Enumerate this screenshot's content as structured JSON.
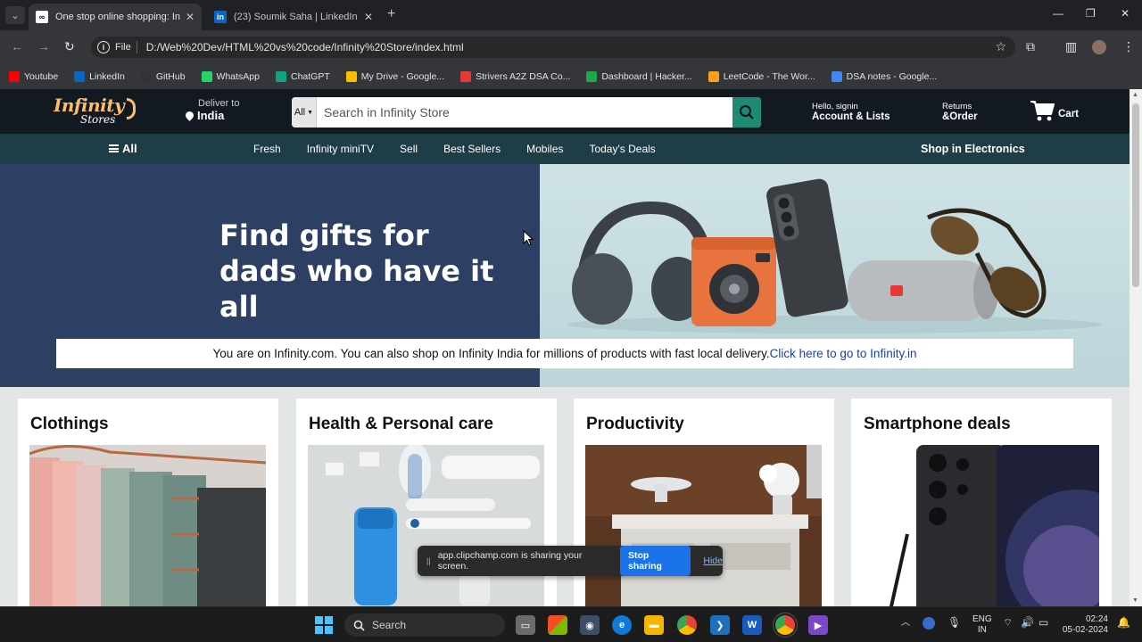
{
  "browser": {
    "tabs": [
      {
        "title": "One stop online shopping: Infin",
        "active": true
      },
      {
        "title": "(23) Soumik Saha | LinkedIn",
        "active": false
      }
    ],
    "url_scheme": "File",
    "url": "D:/Web%20Dev/HTML%20vs%20code/Infinity%20Store/index.html",
    "bookmarks": [
      {
        "label": "Youtube",
        "color": "#ff0000"
      },
      {
        "label": "LinkedIn",
        "color": "#0a66c2"
      },
      {
        "label": "GitHub",
        "color": "#333333"
      },
      {
        "label": "WhatsApp",
        "color": "#25d366"
      },
      {
        "label": "ChatGPT",
        "color": "#10a37f"
      },
      {
        "label": "My Drive - Google...",
        "color": "#fbbc04"
      },
      {
        "label": "Strivers A2Z DSA Co...",
        "color": "#e53935"
      },
      {
        "label": "Dashboard | Hacker...",
        "color": "#1ba94c"
      },
      {
        "label": "LeetCode - The Wor...",
        "color": "#ffa116"
      },
      {
        "label": "DSA notes - Google...",
        "color": "#4285f4"
      }
    ]
  },
  "header": {
    "logo_main": "Infinity",
    "logo_sub": "Stores",
    "deliver_label": "Deliver to",
    "deliver_location": "India",
    "search_category": "All",
    "search_placeholder": "Search in Infinity Store",
    "account_line1": "Hello, signin",
    "account_line2": "Account & Lists",
    "returns_line1": "Returns",
    "returns_line2": "&Order",
    "cart_label": "Cart"
  },
  "nav": {
    "all_label": "All",
    "links": [
      "Fresh",
      "Infinity miniTV",
      "Sell",
      "Best Sellers",
      "Mobiles",
      "Today's Deals"
    ],
    "right_link": "Shop in Electronics"
  },
  "hero": {
    "title_line1": "Find gifts for",
    "title_line2": "dads who have it all",
    "notice_text": "You are on Infinity.com. You can also shop on Infinity India for millions of products with fast local delivery.",
    "notice_link": "Click here to go to Infinity.in"
  },
  "cards": [
    {
      "title": "Clothings"
    },
    {
      "title": "Health & Personal care"
    },
    {
      "title": "Productivity"
    },
    {
      "title": "Smartphone deals"
    }
  ],
  "share_bar": {
    "message": "app.clipchamp.com is sharing your screen.",
    "stop_label": "Stop sharing",
    "hide_label": "Hide"
  },
  "taskbar": {
    "search_label": "Search",
    "lang_line1": "ENG",
    "lang_line2": "IN",
    "time": "02:24",
    "date": "05-02-2024"
  },
  "colors": {
    "header_bg": "#131921",
    "nav_bg": "#1f3d47",
    "hero_left_bg": "#2e3f64",
    "search_button": "#1d8b73",
    "accent_logo": "#febd69"
  }
}
